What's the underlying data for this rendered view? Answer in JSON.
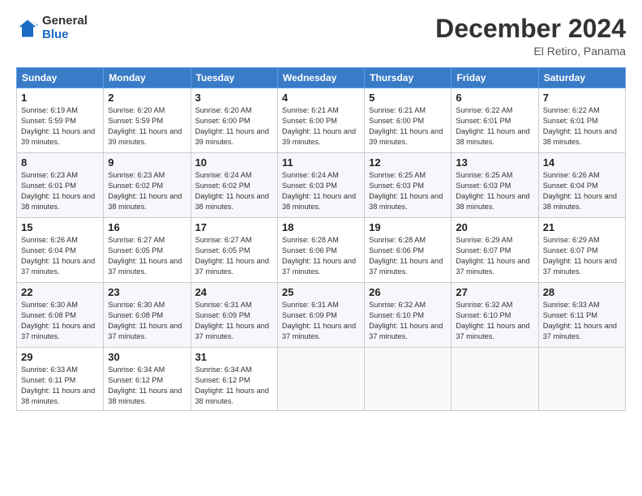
{
  "logo": {
    "general": "General",
    "blue": "Blue"
  },
  "title": "December 2024",
  "location": "El Retiro, Panama",
  "days_header": [
    "Sunday",
    "Monday",
    "Tuesday",
    "Wednesday",
    "Thursday",
    "Friday",
    "Saturday"
  ],
  "weeks": [
    [
      {
        "day": "1",
        "sunrise": "6:19 AM",
        "sunset": "5:59 PM",
        "daylight": "11 hours and 39 minutes."
      },
      {
        "day": "2",
        "sunrise": "6:20 AM",
        "sunset": "5:59 PM",
        "daylight": "11 hours and 39 minutes."
      },
      {
        "day": "3",
        "sunrise": "6:20 AM",
        "sunset": "6:00 PM",
        "daylight": "11 hours and 39 minutes."
      },
      {
        "day": "4",
        "sunrise": "6:21 AM",
        "sunset": "6:00 PM",
        "daylight": "11 hours and 39 minutes."
      },
      {
        "day": "5",
        "sunrise": "6:21 AM",
        "sunset": "6:00 PM",
        "daylight": "11 hours and 39 minutes."
      },
      {
        "day": "6",
        "sunrise": "6:22 AM",
        "sunset": "6:01 PM",
        "daylight": "11 hours and 38 minutes."
      },
      {
        "day": "7",
        "sunrise": "6:22 AM",
        "sunset": "6:01 PM",
        "daylight": "11 hours and 38 minutes."
      }
    ],
    [
      {
        "day": "8",
        "sunrise": "6:23 AM",
        "sunset": "6:01 PM",
        "daylight": "11 hours and 38 minutes."
      },
      {
        "day": "9",
        "sunrise": "6:23 AM",
        "sunset": "6:02 PM",
        "daylight": "11 hours and 38 minutes."
      },
      {
        "day": "10",
        "sunrise": "6:24 AM",
        "sunset": "6:02 PM",
        "daylight": "11 hours and 38 minutes."
      },
      {
        "day": "11",
        "sunrise": "6:24 AM",
        "sunset": "6:03 PM",
        "daylight": "11 hours and 38 minutes."
      },
      {
        "day": "12",
        "sunrise": "6:25 AM",
        "sunset": "6:03 PM",
        "daylight": "11 hours and 38 minutes."
      },
      {
        "day": "13",
        "sunrise": "6:25 AM",
        "sunset": "6:03 PM",
        "daylight": "11 hours and 38 minutes."
      },
      {
        "day": "14",
        "sunrise": "6:26 AM",
        "sunset": "6:04 PM",
        "daylight": "11 hours and 38 minutes."
      }
    ],
    [
      {
        "day": "15",
        "sunrise": "6:26 AM",
        "sunset": "6:04 PM",
        "daylight": "11 hours and 37 minutes."
      },
      {
        "day": "16",
        "sunrise": "6:27 AM",
        "sunset": "6:05 PM",
        "daylight": "11 hours and 37 minutes."
      },
      {
        "day": "17",
        "sunrise": "6:27 AM",
        "sunset": "6:05 PM",
        "daylight": "11 hours and 37 minutes."
      },
      {
        "day": "18",
        "sunrise": "6:28 AM",
        "sunset": "6:06 PM",
        "daylight": "11 hours and 37 minutes."
      },
      {
        "day": "19",
        "sunrise": "6:28 AM",
        "sunset": "6:06 PM",
        "daylight": "11 hours and 37 minutes."
      },
      {
        "day": "20",
        "sunrise": "6:29 AM",
        "sunset": "6:07 PM",
        "daylight": "11 hours and 37 minutes."
      },
      {
        "day": "21",
        "sunrise": "6:29 AM",
        "sunset": "6:07 PM",
        "daylight": "11 hours and 37 minutes."
      }
    ],
    [
      {
        "day": "22",
        "sunrise": "6:30 AM",
        "sunset": "6:08 PM",
        "daylight": "11 hours and 37 minutes."
      },
      {
        "day": "23",
        "sunrise": "6:30 AM",
        "sunset": "6:08 PM",
        "daylight": "11 hours and 37 minutes."
      },
      {
        "day": "24",
        "sunrise": "6:31 AM",
        "sunset": "6:09 PM",
        "daylight": "11 hours and 37 minutes."
      },
      {
        "day": "25",
        "sunrise": "6:31 AM",
        "sunset": "6:09 PM",
        "daylight": "11 hours and 37 minutes."
      },
      {
        "day": "26",
        "sunrise": "6:32 AM",
        "sunset": "6:10 PM",
        "daylight": "11 hours and 37 minutes."
      },
      {
        "day": "27",
        "sunrise": "6:32 AM",
        "sunset": "6:10 PM",
        "daylight": "11 hours and 37 minutes."
      },
      {
        "day": "28",
        "sunrise": "6:33 AM",
        "sunset": "6:11 PM",
        "daylight": "11 hours and 37 minutes."
      }
    ],
    [
      {
        "day": "29",
        "sunrise": "6:33 AM",
        "sunset": "6:11 PM",
        "daylight": "11 hours and 38 minutes."
      },
      {
        "day": "30",
        "sunrise": "6:34 AM",
        "sunset": "6:12 PM",
        "daylight": "11 hours and 38 minutes."
      },
      {
        "day": "31",
        "sunrise": "6:34 AM",
        "sunset": "6:12 PM",
        "daylight": "11 hours and 38 minutes."
      },
      null,
      null,
      null,
      null
    ]
  ]
}
